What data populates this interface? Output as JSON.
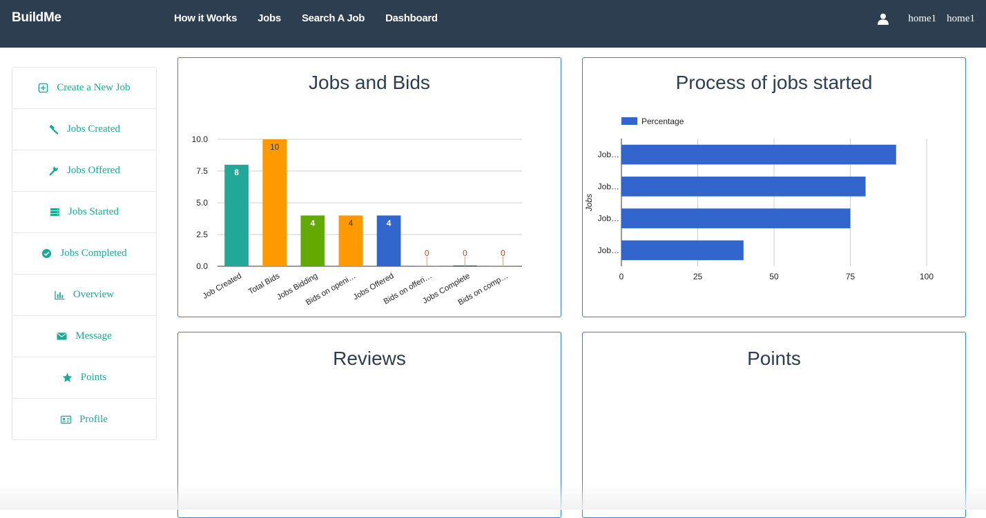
{
  "navbar": {
    "brand": "BuildMe",
    "links": [
      "How it Works",
      "Jobs",
      "Search A Job",
      "Dashboard"
    ],
    "user_icon": "user-icon",
    "user_links": [
      "home1",
      "home1"
    ]
  },
  "sidebar": {
    "items": [
      {
        "label": "Create a New Job",
        "icon": "plus-square-icon"
      },
      {
        "label": "Jobs Created",
        "icon": "gavel-icon"
      },
      {
        "label": "Jobs Offered",
        "icon": "wrench-icon"
      },
      {
        "label": "Jobs Started",
        "icon": "server-icon"
      },
      {
        "label": "Jobs Completed",
        "icon": "check-circle-icon"
      },
      {
        "label": "Overview",
        "icon": "bar-chart-icon"
      },
      {
        "label": "Message",
        "icon": "envelope-icon"
      },
      {
        "label": "Points",
        "icon": "star-icon"
      },
      {
        "label": "Profile",
        "icon": "id-card-icon"
      }
    ]
  },
  "panels": {
    "jobs_bids_title": "Jobs and Bids",
    "process_title": "Process of jobs started",
    "reviews_title": "Reviews",
    "points_title": "Points"
  },
  "colors": {
    "navbar": "#2c3e50",
    "accent": "#1aaa93",
    "panel_border": "#2c88c6"
  },
  "chart_data": [
    {
      "type": "bar",
      "title": "Jobs and Bids",
      "categories": [
        "Job Created",
        "Total Bids",
        "Jobs Bidding",
        "Bids on openi…",
        "Jobs Offered",
        "Bids on offeri…",
        "Jobs Complete",
        "Bids on comp…"
      ],
      "values": [
        8,
        10,
        4,
        4,
        4,
        0,
        0,
        0
      ],
      "value_labels": [
        "8",
        "10",
        "4",
        "4",
        "4",
        "0",
        "0",
        "0"
      ],
      "colors": [
        "#20a998",
        "#ff9900",
        "#62aa00",
        "#ff9900",
        "#3366cc",
        "#ff9900",
        "#990099",
        "#ff9900"
      ],
      "ylim": [
        0,
        10
      ],
      "yticks": [
        "0.0",
        "2.5",
        "5.0",
        "7.5",
        "10.0"
      ],
      "grid": true
    },
    {
      "type": "bar",
      "orientation": "horizontal",
      "title": "Process of jobs started",
      "categories": [
        "Job…",
        "Job…",
        "Job…",
        "Job…"
      ],
      "series": [
        {
          "name": "Percentage",
          "values": [
            90,
            80,
            75,
            40
          ],
          "color": "#3366cc"
        }
      ],
      "ylabel": "Jobs",
      "xlim": [
        0,
        100
      ],
      "xticks": [
        "0",
        "25",
        "50",
        "75",
        "100"
      ],
      "legend": "top-left",
      "grid": true
    }
  ]
}
